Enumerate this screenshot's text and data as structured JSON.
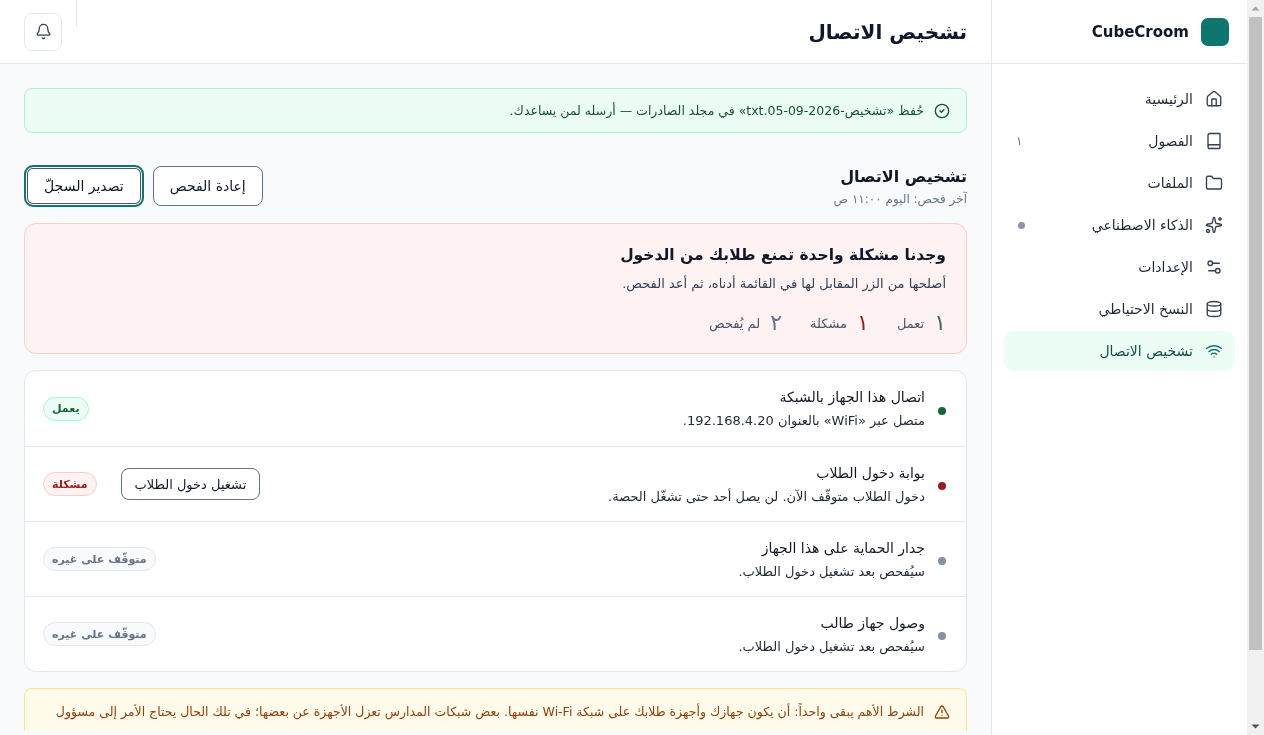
{
  "sidebar": {
    "brand": "CubeCroom",
    "items": [
      {
        "label": "الرئيسية",
        "selected": false,
        "dot": false
      },
      {
        "label": "الفصول",
        "selected": false,
        "dot": false,
        "badge": "١"
      },
      {
        "label": "الملفات",
        "selected": false,
        "dot": false
      },
      {
        "label": "الذكاء الاصطناعي",
        "selected": false,
        "dot": true
      },
      {
        "label": "الإعدادات",
        "selected": false,
        "dot": false
      },
      {
        "label": "النسخ الاحتياطي",
        "selected": false,
        "dot": false
      },
      {
        "label": "تشخيص الاتصال",
        "selected": true,
        "dot": false
      }
    ]
  },
  "header": {
    "title": "تشخيص الاتصال"
  },
  "notice": {
    "text": "حُفظ «تشخيص-2026-09-05.txt» في مجلد الصادرات — أرسله لمن يساعدك."
  },
  "section": {
    "title": "تشخيص الاتصال",
    "subtitle": "آخر فحص: اليوم ١١:٠٠ ص",
    "actions": [
      {
        "label": "إعادة الفحص",
        "focused": false
      },
      {
        "label": "تصدير السجلّ",
        "focused": true
      }
    ]
  },
  "summary": {
    "title": "وجدنا مشكلة واحدة تمنع طلابك من الدخول",
    "text": "أصلحها من الزر المقابل لها في القائمة أدناه، ثم أعد الفحص.",
    "stats": [
      {
        "value": "١",
        "label": "تعمل",
        "color": "#3f6b5c"
      },
      {
        "value": "١",
        "label": "مشكلة",
        "color": "#9b1c1c"
      },
      {
        "value": "٢",
        "label": "لم يُفحص",
        "color": "#64748b"
      }
    ]
  },
  "checks": [
    {
      "kind": "ok",
      "title": "اتصال هذا الجهاز بالشبكة",
      "text": "متصل عبر «WiFi» بالعنوان 192.168.4.20.",
      "badge": "يعمل"
    },
    {
      "kind": "problem",
      "title": "بوابة دخول الطلاب",
      "text": "دخول الطلاب متوقّف الآن. لن يصل أحد حتى تشغّل الحصة.",
      "badge": "مشكلة",
      "action": "تشغيل دخول الطلاب"
    },
    {
      "kind": "waiting",
      "title": "جدار الحماية على هذا الجهاز",
      "text": "سيُفحص بعد تشغيل دخول الطلاب.",
      "badge": "متوقّف على غيره"
    },
    {
      "kind": "waiting",
      "title": "وصول جهاز طالب",
      "text": "سيُفحص بعد تشغيل دخول الطلاب.",
      "badge": "متوقّف على غيره"
    }
  ],
  "warning": {
    "text": "الشرط الأهم يبقى واحداً: أن يكون جهازك وأجهزة طلابك على شبكة Wi-Fi نفسها. بعض شبكات المدارس تعزل الأجهزة عن بعضها؛ في تلك الحال يحتاج الأمر إلى مسؤول"
  }
}
